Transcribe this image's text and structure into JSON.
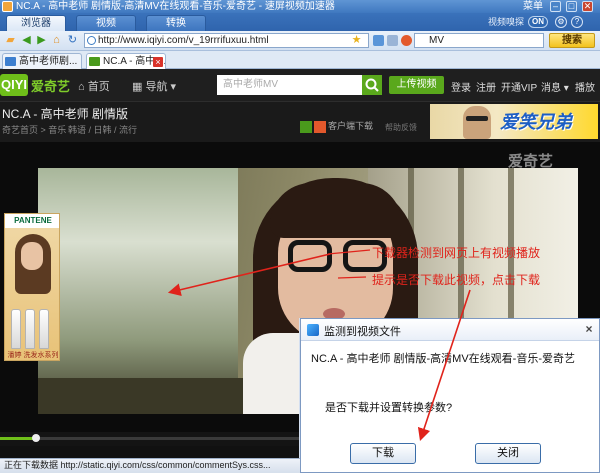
{
  "window": {
    "title": "NC.A - 高中老师 剧情版-高清MV在线观看-音乐-爱奇艺 - 速屏视频加速器",
    "menu_label": "菜单",
    "min_label": "–",
    "max_label": "□",
    "close_label": "✕"
  },
  "toptabs": [
    {
      "label": "浏览器"
    },
    {
      "label": "视频"
    },
    {
      "label": "转换"
    }
  ],
  "mode": {
    "label": "视频嗅探",
    "toggle_label": "ON"
  },
  "address": {
    "url": "http://www.iqiyi.com/v_19rrrifuxuu.html",
    "search_value": "MV",
    "search_button": "搜索"
  },
  "pagetabs": [
    {
      "label": "高中老师剧..."
    },
    {
      "label": "NC.A - 高中 ..."
    }
  ],
  "site": {
    "logo_mark": "QIYI",
    "logo_name": "爱奇艺",
    "home": "首页",
    "nav": "导航",
    "search_placeholder": "高中老师MV",
    "upload": "上传视频",
    "login": "登录",
    "register": "注册",
    "vip": "开通VIP",
    "messages": "消息",
    "more": "播放"
  },
  "video": {
    "title": "NC.A - 高中老师 剧情版",
    "breadcrumb": "奇艺首页 > 音乐",
    "tags": "韩语 / 日韩 / 流行",
    "client_download": "客户端下载",
    "feedback": "帮助反馈",
    "banner_text": "爱笑兄弟",
    "watermark": "爱奇艺",
    "progress": 0.06
  },
  "ad": {
    "brand": "PANTENE",
    "slogan": "潘婷 洗发水系列"
  },
  "annotation": {
    "line1": "下载器检测到网页上有视频播放",
    "line2": "提示是否下载此视频，点击下载"
  },
  "dialog": {
    "title": "监测到视频文件",
    "message": "NC.A - 高中老师 剧情版-高清MV在线观看-音乐-爱奇艺",
    "question": "是否下载并设置转换参数?",
    "download_label": "下载",
    "close_label": "关闭"
  },
  "status": {
    "text": "正在下载数据 http://static.qiyi.com/css/common/commentSys.css..."
  }
}
